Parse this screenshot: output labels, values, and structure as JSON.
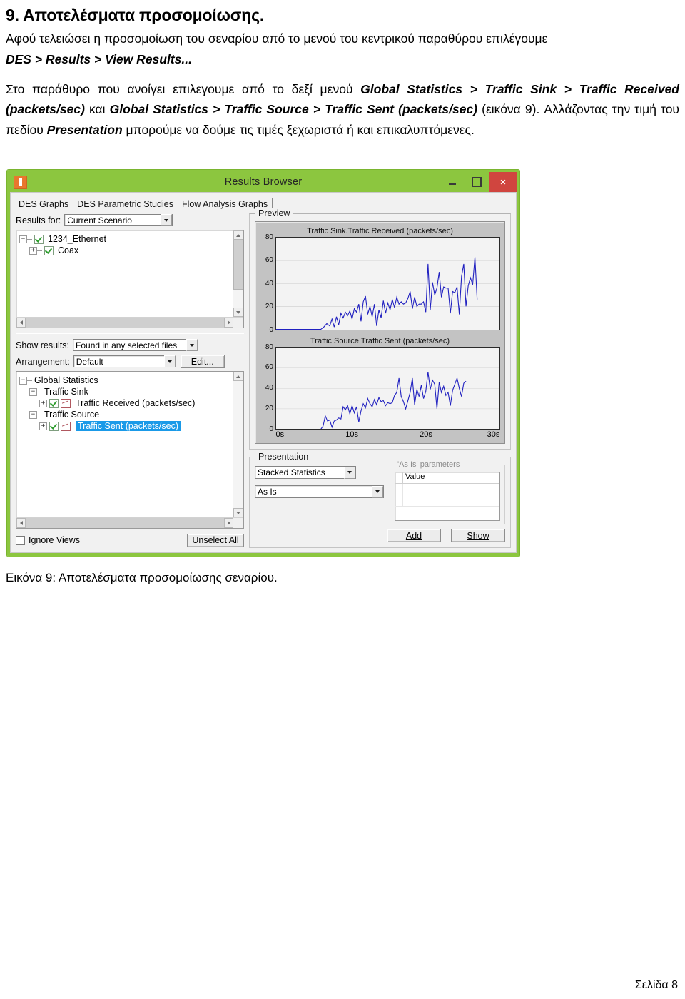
{
  "document": {
    "section_title": "9. Αποτελέσματα προσομοίωσης.",
    "para1_a": "Αφού τελειώσει η προσομοίωση του σεναρίου από το μενού του κεντρικού παραθύρου επιλέγουμε ",
    "para1_menu": "DES > Results > View Results...",
    "para2_a": "Στο παράθυρο που ανοίγει επιλεγουμε από το δεξί μενού ",
    "para2_path1": "Global Statistics > Traffic Sink > Traffic Received (packets/sec)",
    "para2_b": " και ",
    "para2_path2": "Global Statistics > Traffic Source > Traffic Sent (packets/sec)",
    "para2_c": " (εικόνα 9). Αλλάζοντας την τιμή του πεδίου ",
    "para2_field": "Presentation",
    "para2_d": " μπορούμε να δούμε τις τιμές ξεχωριστά ή και επικαλυπτόμενες.",
    "caption": "Εικόνα 9: Αποτελέσματα προσομοίωσης σεναρίου.",
    "footer": "Σελίδα 8"
  },
  "window": {
    "title": "Results Browser",
    "icon": "app-icon",
    "buttons": {
      "minimize": "–",
      "maximize": "□",
      "close": "×"
    },
    "accent_color": "#8cc63f",
    "close_color": "#d0453f"
  },
  "tabs": [
    {
      "label": "DES Graphs",
      "active": true
    },
    {
      "label": "DES Parametric Studies",
      "active": false
    },
    {
      "label": "Flow Analysis Graphs",
      "active": false
    }
  ],
  "left_panel": {
    "results_for": {
      "label": "Results for:",
      "value": "Current Scenario"
    },
    "scenario_tree": [
      {
        "label": "1234_Ethernet",
        "expander": "-",
        "checked": true,
        "indent": 0
      },
      {
        "label": "Coax",
        "expander": "+",
        "checked": true,
        "indent": 1
      }
    ],
    "show_results": {
      "label": "Show results:",
      "value": "Found in any selected files"
    },
    "arrangement": {
      "label": "Arrangement:",
      "value": "Default"
    },
    "edit_button": "Edit...",
    "stats_tree": [
      {
        "label": "Global Statistics",
        "expander": "-",
        "indent": 0,
        "checkbox": false,
        "graph_icon": false,
        "selected": false
      },
      {
        "label": "Traffic Sink",
        "expander": "-",
        "indent": 1,
        "checkbox": false,
        "graph_icon": false,
        "selected": false
      },
      {
        "label": "Traffic Received (packets/sec)",
        "expander": "+",
        "indent": 2,
        "checkbox": true,
        "graph_icon": true,
        "selected": false
      },
      {
        "label": "Traffic Source",
        "expander": "-",
        "indent": 1,
        "checkbox": false,
        "graph_icon": false,
        "selected": false
      },
      {
        "label": "Traffic Sent (packets/sec)",
        "expander": "+",
        "indent": 2,
        "checkbox": true,
        "graph_icon": true,
        "selected": true
      }
    ],
    "ignore_views": {
      "label": "Ignore Views",
      "checked": false
    },
    "unselect_all": "Unselect All"
  },
  "preview": {
    "group_title": "Preview"
  },
  "presentation": {
    "group_title": "Presentation",
    "mode": "Stacked Statistics",
    "as_is": "As Is",
    "params_title": "'As Is' parameters",
    "params_column": "Value",
    "add_button": "Add",
    "show_button": "Show"
  },
  "chart_data": [
    {
      "type": "line",
      "title": "Traffic Sink.Traffic Received (packets/sec)",
      "xlabel": "",
      "ylabel": "",
      "xlim": [
        0,
        30
      ],
      "ylim": [
        0,
        80
      ],
      "yticks": [
        80,
        60,
        40,
        20,
        0
      ],
      "xticks": [],
      "xtick_labels": [],
      "grid": true,
      "line_color": "#2020c0",
      "series": [
        {
          "name": "Traffic Received (packets/sec)",
          "x": [
            0,
            1,
            2,
            3,
            4,
            5,
            6,
            6.4,
            6.8,
            7.2,
            7.5,
            7.8,
            8.1,
            8.4,
            8.7,
            9.0,
            9.3,
            9.6,
            9.9,
            10.2,
            10.5,
            10.8,
            11.1,
            11.4,
            11.7,
            12.0,
            12.3,
            12.6,
            12.9,
            13.2,
            13.5,
            13.8,
            14.1,
            14.4,
            14.7,
            15.0,
            15.3,
            15.6,
            15.9,
            16.2,
            16.5,
            16.8,
            17.1,
            17.4,
            17.7,
            18.0,
            18.3,
            18.6,
            18.9,
            19.2,
            19.5,
            19.8,
            20.1,
            20.4,
            20.7,
            21.0,
            21.3,
            21.6,
            21.9,
            22.2,
            22.5,
            22.8,
            23.1,
            23.4,
            23.7,
            24.0,
            24.3,
            24.6,
            24.9,
            25.2,
            25.5,
            25.8,
            26.1,
            26.4,
            26.7,
            27.0,
            27.3,
            27.6,
            27.9,
            28.2,
            28.5,
            28.8,
            29.1,
            29.4,
            29.7
          ],
          "y": [
            0,
            0,
            0,
            0,
            0,
            0,
            0,
            2,
            5,
            3,
            9,
            2,
            11,
            4,
            14,
            10,
            15,
            12,
            16,
            9,
            18,
            15,
            22,
            7,
            24,
            29,
            13,
            20,
            11,
            22,
            3,
            17,
            10,
            25,
            14,
            23,
            17,
            26,
            19,
            28,
            22,
            24,
            22,
            23,
            27,
            33,
            18,
            28,
            20,
            22,
            22,
            24,
            15,
            57,
            17,
            41,
            30,
            36,
            50,
            28,
            37,
            36,
            36,
            14,
            33,
            32,
            37,
            13,
            46,
            57,
            20,
            38,
            45,
            39,
            63,
            26
          ]
        }
      ]
    },
    {
      "type": "line",
      "title": "Traffic Source.Traffic Sent (packets/sec)",
      "xlabel": "",
      "ylabel": "",
      "xlim": [
        0,
        30
      ],
      "ylim": [
        0,
        80
      ],
      "yticks": [
        80,
        60,
        40,
        20,
        0
      ],
      "xticks": [
        0,
        10,
        20,
        30
      ],
      "xtick_labels": [
        "0s",
        "10s",
        "20s",
        "30s"
      ],
      "grid": true,
      "line_color": "#2020c0",
      "series": [
        {
          "name": "Traffic Sent (packets/sec)",
          "x": [
            0,
            1,
            2,
            3,
            4,
            5,
            6,
            6.3,
            6.6,
            6.9,
            7.2,
            7.5,
            7.8,
            8.1,
            8.4,
            8.7,
            9.0,
            9.3,
            9.6,
            9.9,
            10.2,
            10.5,
            10.8,
            11.1,
            11.4,
            11.7,
            12.0,
            12.3,
            12.6,
            12.9,
            13.2,
            13.5,
            13.8,
            14.1,
            14.4,
            14.7,
            15.0,
            15.3,
            15.6,
            15.9,
            16.2,
            16.5,
            16.8,
            17.1,
            17.4,
            17.7,
            18.0,
            18.3,
            18.6,
            18.9,
            19.2,
            19.5,
            19.8,
            20.1,
            20.4,
            20.7,
            21.0,
            21.3,
            21.6,
            21.9,
            22.2,
            22.5,
            22.8,
            23.1,
            23.4,
            23.7,
            24.0,
            24.3,
            24.6,
            24.9,
            25.2,
            25.5,
            25.8,
            26.1,
            26.4,
            26.7,
            27.0,
            27.3,
            27.6,
            27.9,
            28.2,
            28.5,
            28.8,
            29.1,
            29.4,
            29.7
          ],
          "y": [
            0,
            0,
            0,
            0,
            0,
            0,
            0,
            3,
            13,
            8,
            9,
            2,
            8,
            9,
            11,
            10,
            22,
            19,
            23,
            15,
            23,
            16,
            22,
            7,
            18,
            25,
            21,
            30,
            25,
            22,
            29,
            24,
            31,
            27,
            28,
            23,
            26,
            25,
            26,
            33,
            36,
            50,
            32,
            27,
            20,
            28,
            36,
            50,
            24,
            39,
            32,
            43,
            30,
            37,
            56,
            39,
            48,
            44,
            20,
            46,
            36,
            42,
            33,
            36,
            23,
            38,
            44,
            50,
            40,
            32,
            45,
            47
          ]
        }
      ]
    }
  ]
}
